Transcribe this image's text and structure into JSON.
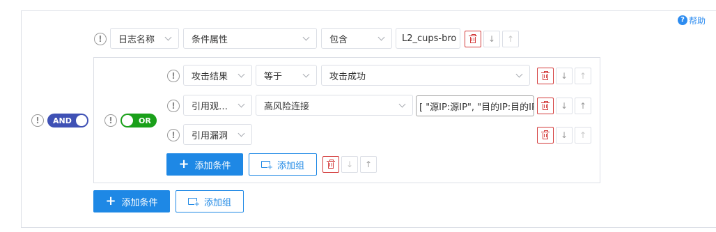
{
  "help": {
    "label": "帮助"
  },
  "root": {
    "logic": "AND",
    "condition1": {
      "field": "日志名称",
      "attribute": "条件属性",
      "operator": "包含",
      "value": "L2_cups-bro"
    },
    "group": {
      "logic": "OR",
      "rows": [
        {
          "field": "攻击结果",
          "operator": "等于",
          "value": "攻击成功"
        },
        {
          "field": "引用观…",
          "value": "高风险连接",
          "extra": "[ \"源IP:源IP\", \"目的IP:目的IP\" ]"
        },
        {
          "field": "引用漏洞"
        }
      ],
      "add_condition_label": "添加条件",
      "add_group_label": "添加组"
    },
    "add_condition_label": "添加条件",
    "add_group_label": "添加组"
  },
  "icons": {
    "down": "↓",
    "up": "↑",
    "info": "!"
  },
  "colors": {
    "accent": "#1e88e5",
    "and_toggle": "#3f51b5",
    "or_toggle": "#1aa01a",
    "danger": "#d33a3a"
  }
}
